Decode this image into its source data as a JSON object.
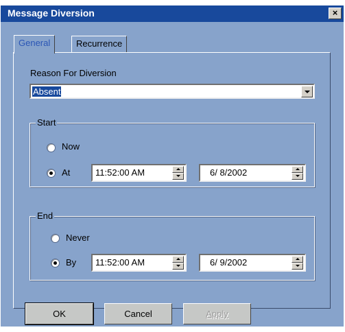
{
  "window": {
    "title": "Message Diversion",
    "close_glyph": "×"
  },
  "tabs": [
    {
      "label": "General",
      "active": true
    },
    {
      "label": "Recurrence",
      "active": false
    }
  ],
  "reason": {
    "label": "Reason For Diversion",
    "selected": "Absent"
  },
  "start": {
    "legend": "Start",
    "options": [
      {
        "label": "Now",
        "checked": false
      },
      {
        "label": "At",
        "checked": true
      }
    ],
    "time": "11:52:00 AM",
    "date": "6/ 8/2002"
  },
  "end": {
    "legend": "End",
    "options": [
      {
        "label": "Never",
        "checked": false
      },
      {
        "label": "By",
        "checked": true
      }
    ],
    "time": "11:52:00 AM",
    "date": "6/ 9/2002"
  },
  "buttons": {
    "ok": "OK",
    "cancel": "Cancel",
    "apply": "Apply",
    "apply_enabled": false
  },
  "colors": {
    "titlebar": "#18499c",
    "dialog_bg": "#87a3cb",
    "selection": "#18499c",
    "active_tab_text": "#2a55b5"
  }
}
